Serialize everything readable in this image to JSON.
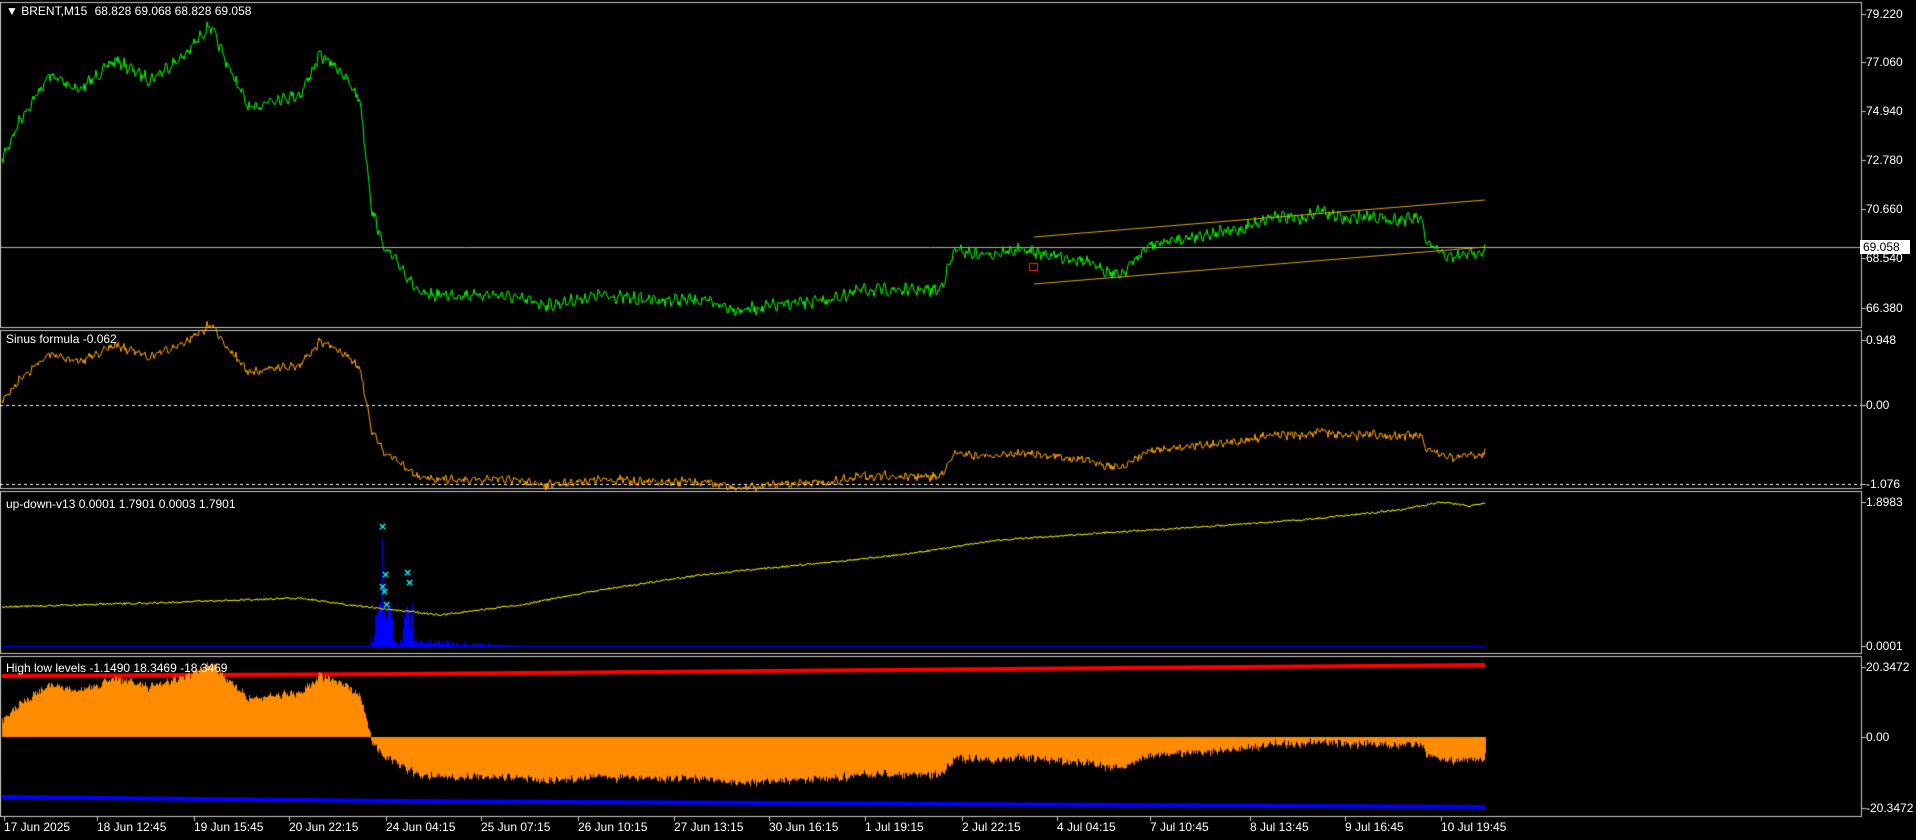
{
  "panes": {
    "main": {
      "symbol_label": "BRENT,M15",
      "ohlc": "68.828 69.068 68.828 69.058",
      "current_price": "69.058",
      "price_ticks": [
        "79.220",
        "77.060",
        "74.940",
        "72.780",
        "70.660",
        "68.540",
        "66.380"
      ]
    },
    "sinus": {
      "label": "Sinus formula -0.062",
      "ticks": [
        "0.948",
        "0.00",
        "-1.076"
      ]
    },
    "updown": {
      "label": "up-down-v13 0.0001 1.7901 0.0003 1.7901",
      "ticks": [
        "1.8983",
        "0.0001"
      ]
    },
    "highlow": {
      "label": "High low levels -1.1490 18.3469 -18.3469",
      "ticks": [
        "20.3472",
        "0.00",
        "-20.3472"
      ]
    }
  },
  "time_axis": [
    "17 Jun 2025",
    "18 Jun 12:45",
    "19 Jun 15:45",
    "20 Jun 22:15",
    "24 Jun 04:15",
    "25 Jun 07:15",
    "26 Jun 10:15",
    "27 Jun 13:15",
    "30 Jun 16:15",
    "1 Jul 19:15",
    "2 Jul 22:15",
    "4 Jul 04:15",
    "7 Jul 10:45",
    "8 Jul 13:45",
    "9 Jul 16:45",
    "10 Jul 19:45"
  ],
  "colors": {
    "background": "#000000",
    "price_line": "#00ff00",
    "sinus_line": "#ffa500",
    "updown_line": "#ffff00",
    "updown_hist": "#0000ff",
    "updown_markers": "#00ffff",
    "high_level": "#ff0000",
    "low_level": "#0000ff",
    "level_fill": "#ff8c00",
    "channel": "#daa520"
  }
}
